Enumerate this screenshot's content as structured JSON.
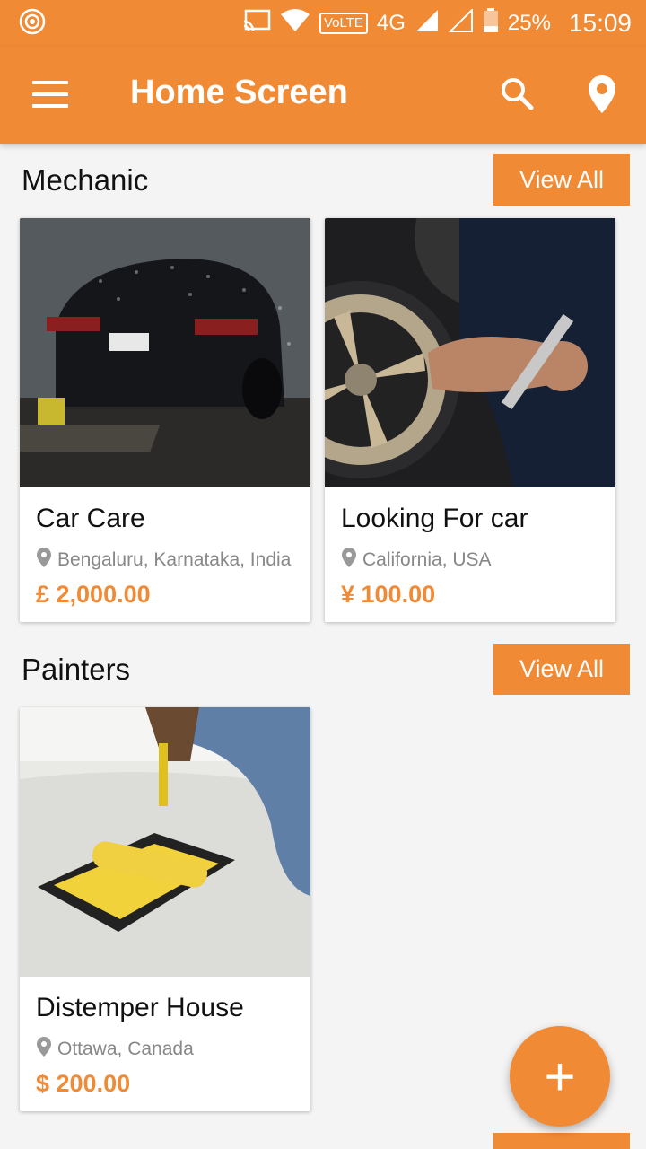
{
  "status_bar": {
    "network": "4G",
    "volte": "VoLTE",
    "battery": "25%",
    "time": "15:09"
  },
  "app_bar": {
    "title": "Home Screen",
    "menu_icon": "hamburger-menu-icon",
    "search_icon": "search-icon",
    "location_icon": "location-pin-icon"
  },
  "sections": [
    {
      "title": "Mechanic",
      "view_all_label": "View All",
      "cards": [
        {
          "name": "Car Care",
          "location": "Bengaluru, Karnataka, India",
          "price": "£ 2,000.00"
        },
        {
          "name": "Looking For car",
          "location": "California, USA",
          "price": "¥ 100.00"
        }
      ]
    },
    {
      "title": "Painters",
      "view_all_label": "View All",
      "cards": [
        {
          "name": "Distemper House",
          "location": "Ottawa, Canada",
          "price": "$ 200.00"
        }
      ]
    }
  ],
  "fab": {
    "label": "+",
    "icon": "add-icon"
  },
  "colors": {
    "accent": "#f08a35",
    "price": "#f08a35",
    "background": "#f4f4f4"
  }
}
